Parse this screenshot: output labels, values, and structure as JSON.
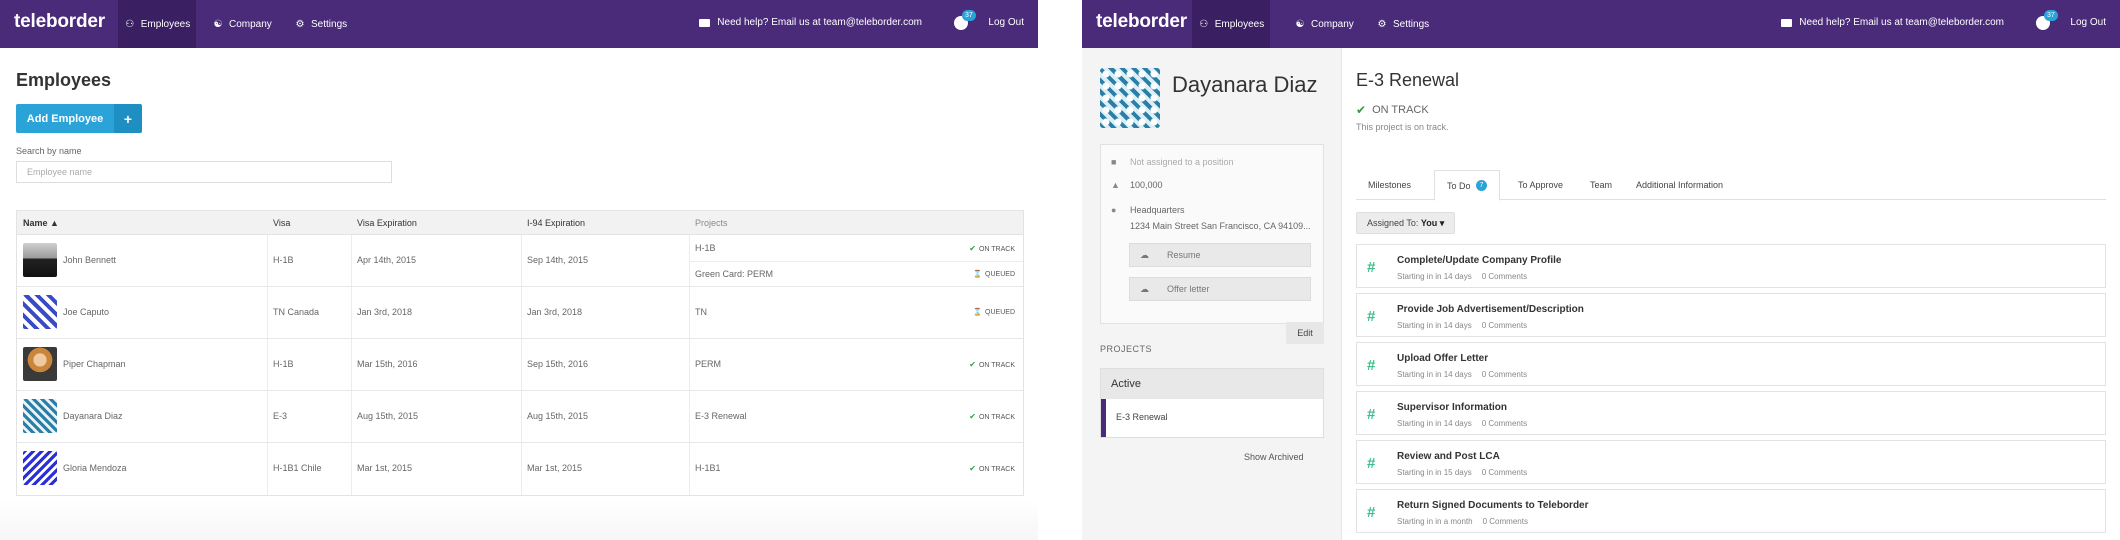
{
  "nav": {
    "brand": "teleborder",
    "tabs": [
      {
        "label": "Employees",
        "icon": "people-icon"
      },
      {
        "label": "Company",
        "icon": "org-chart-icon"
      },
      {
        "label": "Settings",
        "icon": "gear-icon"
      }
    ],
    "help_text": "Need help? Email us at team@teleborder.com",
    "notif_count": "37",
    "logout": "Log Out"
  },
  "employees_page": {
    "title": "Employees",
    "add_button": "Add Employee",
    "add_plus": "+",
    "search_label": "Search by name",
    "search_placeholder": "Employee name",
    "columns": [
      "Name ▲",
      "Visa",
      "Visa Expiration",
      "I-94 Expiration",
      "Projects"
    ],
    "rows": [
      {
        "name": "John Bennett",
        "visa": "H-1B",
        "visa_exp": "Apr 14th, 2015",
        "i94_exp": "Sep 14th, 2015",
        "projects": [
          {
            "name": "H-1B",
            "status": "ON TRACK"
          },
          {
            "name": "Green Card: PERM",
            "status": "QUEUED"
          }
        ]
      },
      {
        "name": "Joe Caputo",
        "visa": "TN Canada",
        "visa_exp": "Jan 3rd, 2018",
        "i94_exp": "Jan 3rd, 2018",
        "projects": [
          {
            "name": "TN",
            "status": "QUEUED"
          }
        ]
      },
      {
        "name": "Piper Chapman",
        "visa": "H-1B",
        "visa_exp": "Mar 15th, 2016",
        "i94_exp": "Sep 15th, 2016",
        "projects": [
          {
            "name": "PERM",
            "status": "ON TRACK"
          }
        ]
      },
      {
        "name": "Dayanara Diaz",
        "visa": "E-3",
        "visa_exp": "Aug 15th, 2015",
        "i94_exp": "Aug 15th, 2015",
        "projects": [
          {
            "name": "E-3 Renewal",
            "status": "ON TRACK"
          }
        ]
      },
      {
        "name": "Gloria Mendoza",
        "visa": "H-1B1 Chile",
        "visa_exp": "Mar 1st, 2015",
        "i94_exp": "Mar 1st, 2015",
        "projects": [
          {
            "name": "H-1B1",
            "status": "ON TRACK"
          }
        ]
      }
    ]
  },
  "detail_page": {
    "employee_name": "Dayanara Diaz",
    "position": "Not assigned to a position",
    "salary": "100,000",
    "location_name": "Headquarters",
    "location_address": "1234 Main Street San Francisco, CA 94109...",
    "resume_label": "Resume",
    "offer_label": "Offer letter",
    "edit_label": "Edit",
    "projects_label": "PROJECTS",
    "active_label": "Active",
    "active_project": "E-3 Renewal",
    "show_archived": "Show Archived",
    "project_title": "E-3 Renewal",
    "status": "ON TRACK",
    "status_sub": "This project is on track.",
    "tabs": [
      "Milestones",
      "To Do",
      "To Approve",
      "Team",
      "Additional Information"
    ],
    "todo_count": "7",
    "assigned_prefix": "Assigned To:",
    "assigned_value": "You ▾",
    "todos": [
      {
        "title": "Complete/Update Company Profile",
        "start": "Starting in in 14 days",
        "comments": "0 Comments"
      },
      {
        "title": "Provide Job Advertisement/Description",
        "start": "Starting in in 14 days",
        "comments": "0 Comments"
      },
      {
        "title": "Upload Offer Letter",
        "start": "Starting in in 14 days",
        "comments": "0 Comments"
      },
      {
        "title": "Supervisor Information",
        "start": "Starting in in 14 days",
        "comments": "0 Comments"
      },
      {
        "title": "Review and Post LCA",
        "start": "Starting in in 15 days",
        "comments": "0 Comments"
      },
      {
        "title": "Return Signed Documents to Teleborder",
        "start": "Starting in in a month",
        "comments": "0 Comments"
      }
    ]
  },
  "colors": {
    "nav_bg": "#4a2b7a",
    "accent": "#2aa3d8",
    "on_track": "#2e9e3e"
  }
}
